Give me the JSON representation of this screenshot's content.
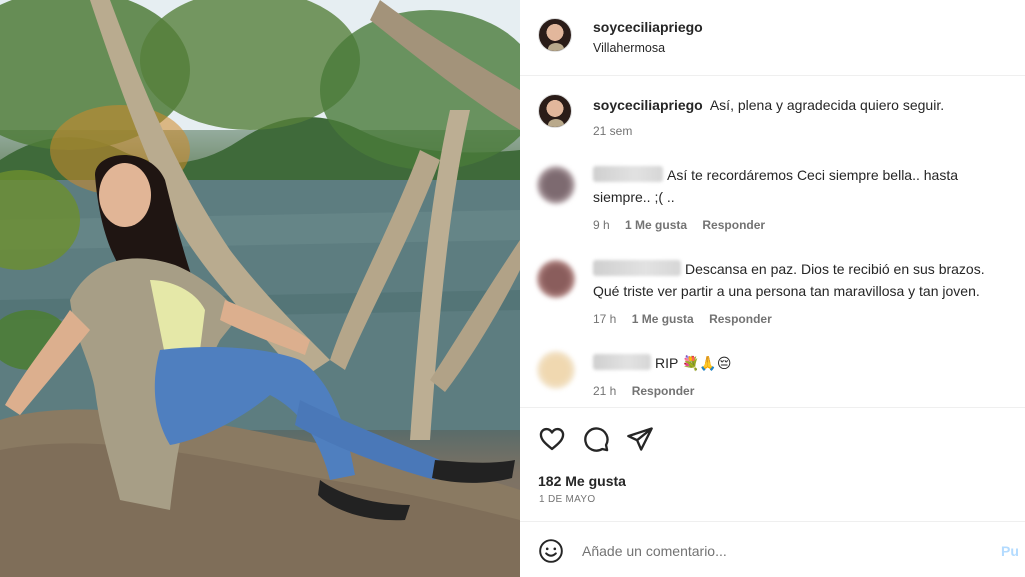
{
  "post": {
    "username": "soyceciliapriego",
    "location": "Villahermosa",
    "caption": "Así, plena y agradecida quiero seguir.",
    "caption_time": "21 sem"
  },
  "comments": [
    {
      "user_blurred": true,
      "line1": "Así te recordáremos Ceci siempre bella.. hasta",
      "line2": "siempre.. ;( ..",
      "time": "9 h",
      "likes": "1 Me gusta",
      "reply": "Responder"
    },
    {
      "user_blurred": true,
      "line1": "Descansa en paz. Dios te recibió en sus brazos.",
      "line2": "Qué triste ver partir a una persona tan maravillosa y tan joven.",
      "time": "17 h",
      "likes": "1 Me gusta",
      "reply": "Responder"
    },
    {
      "user_blurred": true,
      "line1": "RIP 💐🙏😔",
      "time": "21 h",
      "reply": "Responder"
    }
  ],
  "actions": {
    "icons": [
      "heart-icon",
      "comment-icon",
      "share-icon"
    ],
    "likes_count": "182 Me gusta",
    "date": "1 DE MAYO"
  },
  "add_comment": {
    "emoji_icon": "smiley-icon",
    "placeholder": "Añade un comentario...",
    "publish_label": "Pu"
  },
  "colors": {
    "text": "#262626",
    "muted": "#737373",
    "publish": "#b3dbff",
    "divider": "#efefef"
  }
}
